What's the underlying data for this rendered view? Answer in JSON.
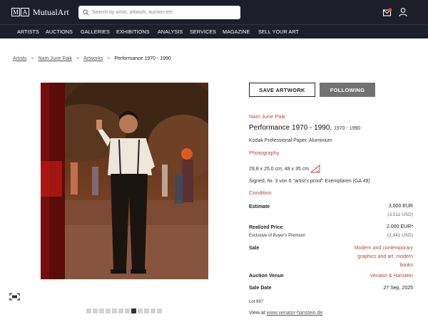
{
  "header": {
    "logo_letters": [
      "M",
      "A"
    ],
    "logo_name": "MutualArt",
    "search_placeholder": "Search by artist, artwork, auction etc."
  },
  "nav": [
    "ARTISTS",
    "AUCTIONS",
    "GALLERIES",
    "EXHIBITIONS",
    "ANALYSIS",
    "SERVICES",
    "MAGAZINE",
    "SELL YOUR ART"
  ],
  "breadcrumb": [
    "Artists",
    "Nam June Paik",
    "Artworks",
    "Performance 1970 - 1990"
  ],
  "buttons": {
    "save": "SAVE ARTWORK",
    "follow": "FOLLOWING"
  },
  "artwork": {
    "artist": "Nam June Paik",
    "title": "Performance 1970 - 1990,",
    "year": "1970 - 1990",
    "medium": "Kodak Professional Paper, Aluminium",
    "category": "Photography",
    "dimensions": "29,8 x 25,0 cm; 48 x 35 cm",
    "inscription": "Signed, Nr. 3 von 6 \"artist's proof\" Exemplaren (GA 49)",
    "condition": "Condition"
  },
  "details": {
    "estimate_label": "Estimate",
    "estimate_value": "3,000 EUR",
    "estimate_usd": "(3,511 USD)",
    "realized_label": "Realized Price",
    "realized_note": "Exclusive of Buyer's Premium",
    "realized_value": "2,000 EUR*",
    "realized_usd": "(2,341 USD)",
    "sale_label": "Sale",
    "sale_value": "Modern and contemporary graphics and art, modern books",
    "venue_label": "Auction Venue",
    "venue_value": "Venator & Hanstein",
    "date_label": "Sale Date",
    "date_value": "27 Sep, 2025",
    "lot": "Lot 997",
    "view_at_prefix": "View at",
    "view_at_link": "www.venator-hanstein.de"
  },
  "gallery": {
    "count": 12,
    "active_index": 7
  },
  "colors": {
    "header_bg": "#1c1f2a",
    "accent_red": "#b5473a",
    "follow_bg": "#727272"
  }
}
